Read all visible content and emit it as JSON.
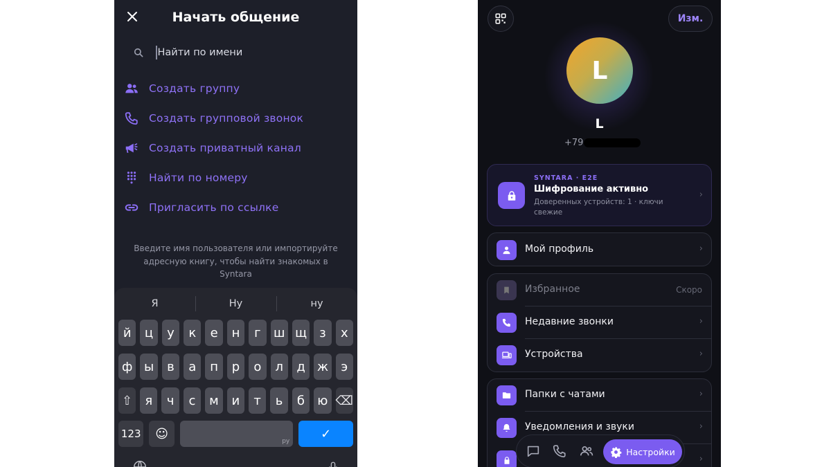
{
  "left_screen": {
    "title": "Начать общение",
    "search": {
      "placeholder": "Найти по имени"
    },
    "actions": [
      {
        "label": "Создать группу",
        "icon": "group-icon"
      },
      {
        "label": "Создать групповой звонок",
        "icon": "phone-icon"
      },
      {
        "label": "Создать приватный канал",
        "icon": "megaphone-icon"
      },
      {
        "label": "Найти по номеру",
        "icon": "dialpad-icon"
      },
      {
        "label": "Пригласить по ссылке",
        "icon": "link-icon"
      }
    ],
    "hint": "Введите имя пользователя или импортируйте адресную книгу, чтобы найти знакомых в Syntara",
    "keyboard": {
      "suggestions": [
        "Я",
        "Ну",
        "ну"
      ],
      "row1": [
        "й",
        "ц",
        "у",
        "к",
        "е",
        "н",
        "г",
        "ш",
        "щ",
        "з",
        "х"
      ],
      "row2": [
        "ф",
        "ы",
        "в",
        "а",
        "п",
        "р",
        "о",
        "л",
        "д",
        "ж",
        "э"
      ],
      "row3": [
        "я",
        "ч",
        "с",
        "м",
        "и",
        "т",
        "ь",
        "б",
        "ю"
      ],
      "numbers_key": "123",
      "space_lang": "ру",
      "shift_symbol": "⇧",
      "backspace_symbol": "⌫",
      "emoji_symbol": "☺",
      "return_symbol": "✓"
    }
  },
  "right_screen": {
    "edit_label": "Изм.",
    "profile": {
      "initial": "L",
      "name": "L",
      "phone_prefix": "+79"
    },
    "encryption": {
      "tag": "SYNTARA · E2E",
      "title": "Шифрование активно",
      "subtitle": "Доверенных устройств: 1 · ключи свежие"
    },
    "menu_profile": {
      "label": "Мой профиль"
    },
    "menu_group1": [
      {
        "label": "Избранное",
        "badge": "Скоро",
        "disabled": true
      },
      {
        "label": "Недавние звонки"
      },
      {
        "label": "Устройства"
      }
    ],
    "menu_group2": [
      {
        "label": "Папки с чатами"
      },
      {
        "label": "Уведомления и звуки"
      }
    ],
    "chevron": "›",
    "tabbar": {
      "active_label": "Настройки"
    }
  },
  "colors": {
    "accent": "#7b5cf0",
    "link": "#8f72f7",
    "keyboard_return": "#0a84ff"
  }
}
